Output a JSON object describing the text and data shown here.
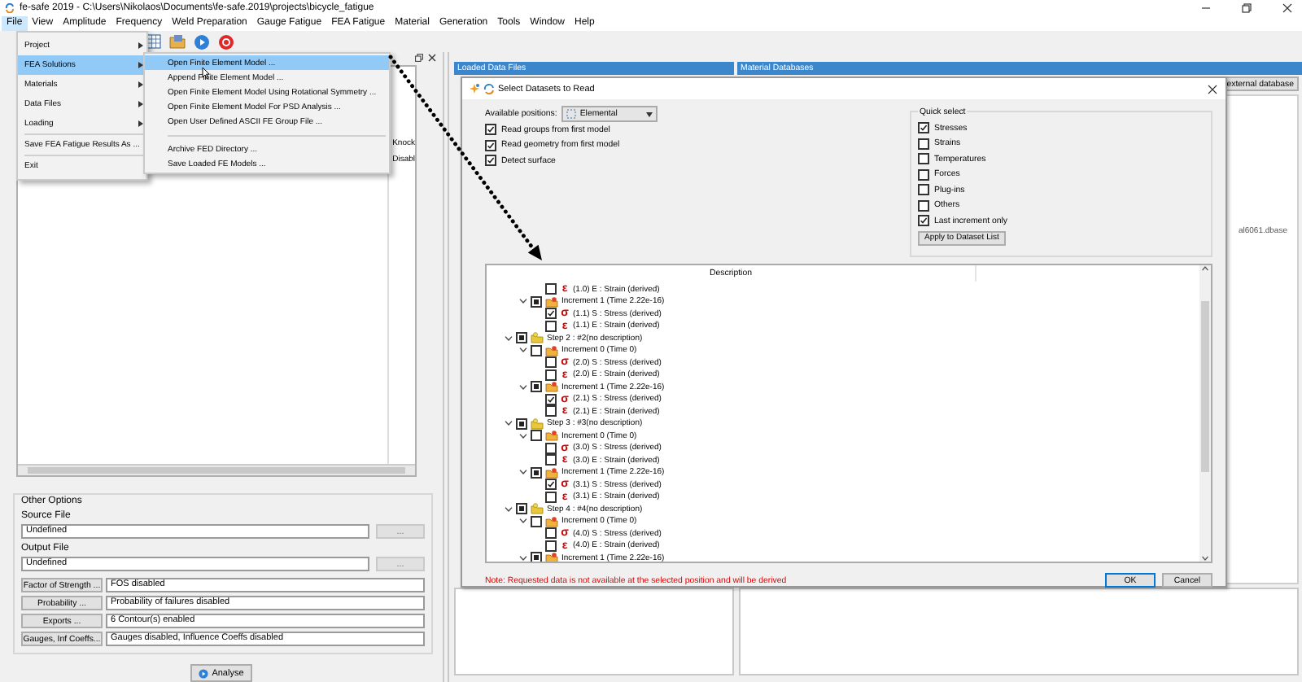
{
  "window": {
    "title": "fe-safe 2019 - C:\\Users\\Nikolaos\\Documents\\fe-safe.2019\\projects\\bicycle_fatigue"
  },
  "menu_bar": [
    {
      "label": "File",
      "selected": true
    },
    {
      "label": "View",
      "selected": false
    },
    {
      "label": "Amplitude",
      "selected": false
    },
    {
      "label": "Frequency",
      "selected": false
    },
    {
      "label": "Weld Preparation",
      "selected": false
    },
    {
      "label": "Gauge Fatigue",
      "selected": false
    },
    {
      "label": "FEA Fatigue",
      "selected": false
    },
    {
      "label": "Material",
      "selected": false
    },
    {
      "label": "Generation",
      "selected": false
    },
    {
      "label": "Tools",
      "selected": false
    },
    {
      "label": "Window",
      "selected": false
    },
    {
      "label": "Help",
      "selected": false
    }
  ],
  "file_menu": [
    {
      "kind": "submenu",
      "label": "Project",
      "selected": false
    },
    {
      "kind": "submenu",
      "label": "FEA Solutions",
      "selected": true
    },
    {
      "kind": "submenu",
      "label": "Materials",
      "selected": false
    },
    {
      "kind": "submenu",
      "label": "Data Files",
      "selected": false
    },
    {
      "kind": "submenu",
      "label": "Loading",
      "selected": false
    },
    {
      "kind": "separator"
    },
    {
      "kind": "item",
      "label": "Save FEA Fatigue Results As ...",
      "selected": false
    },
    {
      "kind": "separator"
    },
    {
      "kind": "item",
      "label": "Exit",
      "selected": false
    }
  ],
  "fea_solutions_menu": [
    {
      "kind": "item",
      "label": "Open Finite Element Model ...",
      "selected": true
    },
    {
      "kind": "item",
      "label": "Append Finite Element Model ...",
      "selected": false
    },
    {
      "kind": "item",
      "label": "Open Finite Element Model Using Rotational Symmetry ...",
      "selected": false
    },
    {
      "kind": "item",
      "label": "Open Finite Element Model For PSD Analysis ...",
      "selected": false
    },
    {
      "kind": "item",
      "label": "Open User Defined ASCII FE Group File ...",
      "selected": false
    },
    {
      "kind": "separator"
    },
    {
      "kind": "item",
      "label": "Archive FED Directory ...",
      "selected": false
    },
    {
      "kind": "item",
      "label": "Save Loaded FE Models ...",
      "selected": false
    }
  ],
  "left_panel": {
    "table_cells": [
      "Knock",
      "Disabl"
    ],
    "other_options": {
      "title": "Other Options",
      "files": [
        {
          "label": "Source File",
          "value": "Undefined",
          "button": "..."
        },
        {
          "label": "Output File",
          "value": "Undefined",
          "button": "..."
        }
      ],
      "settings": [
        {
          "button": "Factor of Strength ...",
          "value": "FOS disabled"
        },
        {
          "button": "Probability ...",
          "value": "Probability of failures disabled"
        },
        {
          "button": "Exports ...",
          "value": "6 Contour(s) enabled"
        },
        {
          "button": "Gauges, Inf Coeffs...",
          "value": "Gauges disabled, Influence Coeffs disabled"
        }
      ]
    },
    "analyse_button": "Analyse"
  },
  "right_panel": {
    "headers": [
      "Loaded Data Files",
      "Material Databases"
    ],
    "external_database_button": "external database",
    "database_file": "al6061.dbase"
  },
  "dialog": {
    "title": "Select Datasets to Read",
    "available_positions": {
      "label": "Available positions:",
      "value": "Elemental"
    },
    "options": [
      {
        "label": "Read groups from first model",
        "checked": true
      },
      {
        "label": "Read geometry from first model",
        "checked": true
      },
      {
        "label": "Detect surface",
        "checked": true
      }
    ],
    "quick_select": {
      "title": "Quick select",
      "items": [
        {
          "label": "Stresses",
          "checked": true
        },
        {
          "label": "Strains",
          "checked": false
        },
        {
          "label": "Temperatures",
          "checked": false
        },
        {
          "label": "Forces",
          "checked": false
        },
        {
          "label": "Plug-ins",
          "checked": false
        },
        {
          "label": "Others",
          "checked": false
        },
        {
          "label": "Last increment only",
          "checked": true
        }
      ],
      "apply_button": "Apply to Dataset List"
    },
    "tree": {
      "column": "Description",
      "items": [
        {
          "kind": "continued",
          "children": [
            {
              "kind": "continued",
              "children": [
                {
                  "kind": "dataset",
                  "symbol": "ε",
                  "label": "(1.0) E : Strain (derived)",
                  "checked": false
                }
              ]
            },
            {
              "kind": "increment",
              "label": "Increment 1 (Time 2.22e-16)",
              "checked": true,
              "partial": true,
              "expanded": true,
              "children": [
                {
                  "kind": "dataset",
                  "symbol": "σ",
                  "label": "(1.1) S : Stress (derived)",
                  "checked": true
                },
                {
                  "kind": "dataset",
                  "symbol": "ε",
                  "label": "(1.1) E : Strain (derived)",
                  "checked": false
                }
              ]
            }
          ]
        },
        {
          "kind": "step",
          "label": "Step 2 : #2(no description)",
          "checked": true,
          "partial": true,
          "expanded": true,
          "children": [
            {
              "kind": "increment",
              "label": "Increment 0 (Time 0)",
              "checked": false,
              "expanded": true,
              "children": [
                {
                  "kind": "dataset",
                  "symbol": "σ",
                  "label": "(2.0) S : Stress (derived)",
                  "checked": false
                },
                {
                  "kind": "dataset",
                  "symbol": "ε",
                  "label": "(2.0) E : Strain (derived)",
                  "checked": false
                }
              ]
            },
            {
              "kind": "increment",
              "label": "Increment 1 (Time 2.22e-16)",
              "checked": true,
              "partial": true,
              "expanded": true,
              "children": [
                {
                  "kind": "dataset",
                  "symbol": "σ",
                  "label": "(2.1) S : Stress (derived)",
                  "checked": true
                },
                {
                  "kind": "dataset",
                  "symbol": "ε",
                  "label": "(2.1) E : Strain (derived)",
                  "checked": false
                }
              ]
            }
          ]
        },
        {
          "kind": "step",
          "label": "Step 3 : #3(no description)",
          "checked": true,
          "partial": true,
          "expanded": true,
          "children": [
            {
              "kind": "increment",
              "label": "Increment 0 (Time 0)",
              "checked": false,
              "expanded": true,
              "children": [
                {
                  "kind": "dataset",
                  "symbol": "σ",
                  "label": "(3.0) S : Stress (derived)",
                  "checked": false
                },
                {
                  "kind": "dataset",
                  "symbol": "ε",
                  "label": "(3.0) E : Strain (derived)",
                  "checked": false
                }
              ]
            },
            {
              "kind": "increment",
              "label": "Increment 1 (Time 2.22e-16)",
              "checked": true,
              "partial": true,
              "expanded": true,
              "children": [
                {
                  "kind": "dataset",
                  "symbol": "σ",
                  "label": "(3.1) S : Stress (derived)",
                  "checked": true
                },
                {
                  "kind": "dataset",
                  "symbol": "ε",
                  "label": "(3.1) E : Strain (derived)",
                  "checked": false
                }
              ]
            }
          ]
        },
        {
          "kind": "step",
          "label": "Step 4 : #4(no description)",
          "checked": true,
          "partial": true,
          "expanded": true,
          "children": [
            {
              "kind": "increment",
              "label": "Increment 0 (Time 0)",
              "checked": false,
              "expanded": true,
              "children": [
                {
                  "kind": "dataset",
                  "symbol": "σ",
                  "label": "(4.0) S : Stress (derived)",
                  "checked": false
                },
                {
                  "kind": "dataset",
                  "symbol": "ε",
                  "label": "(4.0) E : Strain (derived)",
                  "checked": false
                }
              ]
            },
            {
              "kind": "increment",
              "label": "Increment 1 (Time 2.22e-16)",
              "checked": true,
              "partial": true,
              "expanded": true
            }
          ]
        }
      ]
    },
    "note": "Note: Requested data is not available at the selected position and will be derived",
    "buttons": [
      "OK",
      "Cancel"
    ]
  }
}
